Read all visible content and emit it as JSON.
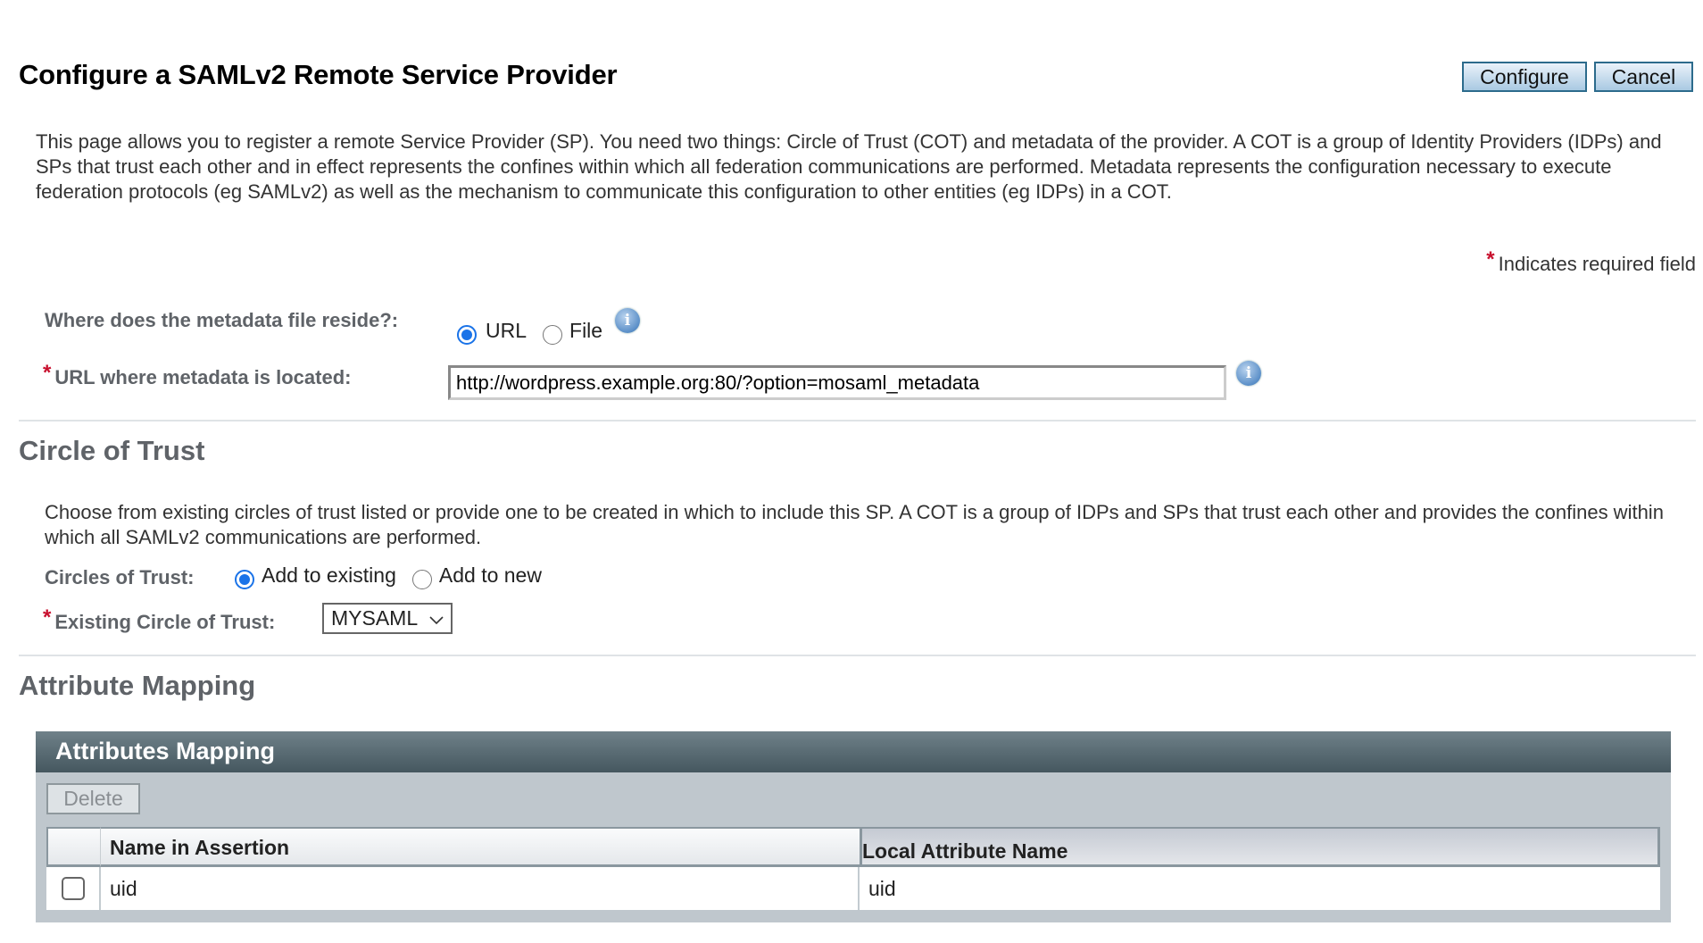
{
  "page": {
    "title": "Configure a SAMLv2 Remote Service Provider",
    "buttons": {
      "configure": "Configure",
      "cancel": "Cancel"
    },
    "description": "This page allows you to register a remote Service Provider (SP). You need two things: Circle of Trust (COT) and metadata of the provider. A COT is a group of Identity Providers (IDPs) and SPs that trust each other and in effect represents the confines within which all federation communications are performed. Metadata represents the configuration necessary to execute federation protocols (eg SAMLv2) as well as the mechanism to communicate this configuration to other entities (eg IDPs) in a COT.",
    "required_marker": "*",
    "required_note": "Indicates required field"
  },
  "metadata": {
    "location_label": "Where does the metadata file reside?:",
    "location_options": [
      {
        "label": "URL",
        "selected": true
      },
      {
        "label": "File",
        "selected": false
      }
    ],
    "url_label": "URL where metadata is located:",
    "url_value": "http://wordpress.example.org:80/?option=mosaml_metadata",
    "info_icon": "info-icon"
  },
  "circle_of_trust": {
    "heading": "Circle of Trust",
    "description": "Choose from existing circles of trust listed or provide one to be created in which to include this SP. A COT is a group of IDPs and SPs that trust each other and provides the confines within which all SAMLv2 communications are performed.",
    "cot_label": "Circles of Trust:",
    "cot_options": [
      {
        "label": "Add to existing",
        "selected": true
      },
      {
        "label": "Add to new",
        "selected": false
      }
    ],
    "existing_label": "Existing Circle of Trust:",
    "existing_value": "MYSAML"
  },
  "attribute_mapping": {
    "heading": "Attribute Mapping",
    "panel_title": "Attributes Mapping",
    "delete_label": "Delete",
    "columns": [
      "Name in Assertion",
      "Local Attribute Name"
    ],
    "rows": [
      {
        "checked": false,
        "name_in_assertion": "uid",
        "local_attribute_name": "uid"
      }
    ]
  },
  "colors": {
    "accent_radio": "#1a73e8",
    "required": "#c8102e",
    "panel_header": "#45575f",
    "button_border": "#2c6b8c"
  }
}
